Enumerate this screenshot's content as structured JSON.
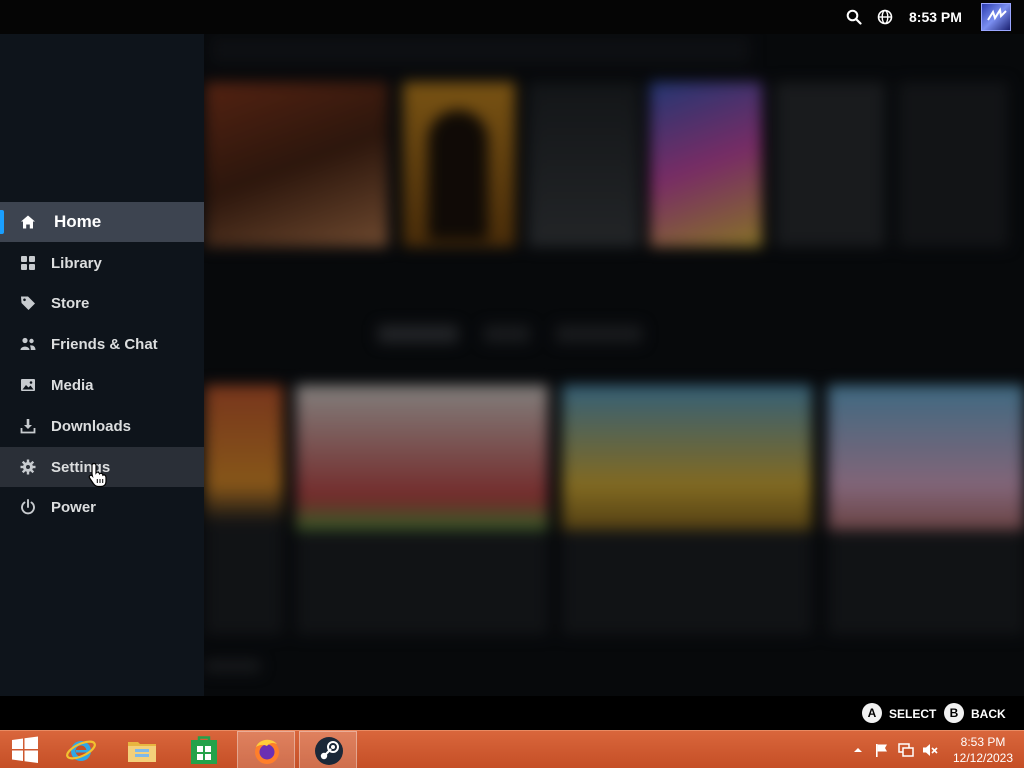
{
  "topbar": {
    "clock": "8:53 PM",
    "icons": [
      "search-icon",
      "globe-icon"
    ]
  },
  "sidemenu": {
    "items": [
      {
        "label": "Home",
        "icon": "home-icon",
        "state": "active"
      },
      {
        "label": "Library",
        "icon": "grid-icon"
      },
      {
        "label": "Store",
        "icon": "tag-icon"
      },
      {
        "label": "Friends & Chat",
        "icon": "people-icon"
      },
      {
        "label": "Media",
        "icon": "image-icon"
      },
      {
        "label": "Downloads",
        "icon": "download-icon"
      },
      {
        "label": "Settings",
        "icon": "gear-icon",
        "state": "hover"
      },
      {
        "label": "Power",
        "icon": "power-icon"
      }
    ]
  },
  "hints": {
    "select_button": "A",
    "select_label": "SELECT",
    "back_button": "B",
    "back_label": "BACK"
  },
  "taskbar": {
    "apps": [
      "windows-start",
      "internet-explorer",
      "file-explorer",
      "windows-store",
      "firefox",
      "steam"
    ],
    "time": "8:53 PM",
    "date": "12/12/2023"
  },
  "colors": {
    "accent": "#1a9fff",
    "menu_bg": "#0e141b",
    "active_bg": "#3d4450",
    "taskbar": "#c54f26"
  }
}
